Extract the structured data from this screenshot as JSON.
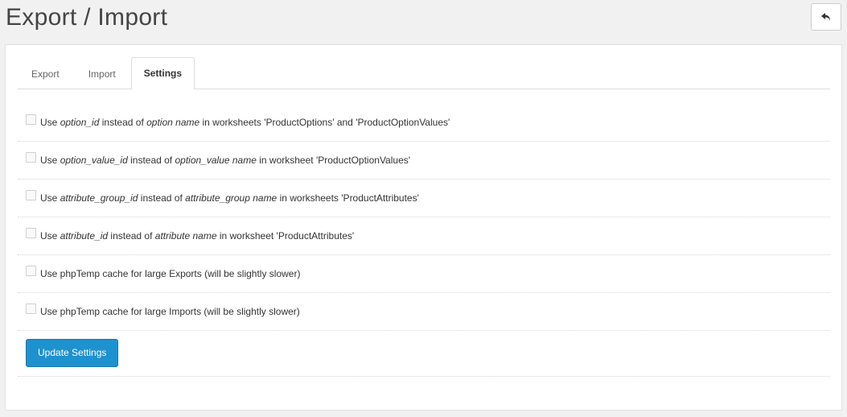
{
  "header": {
    "title": "Export / Import",
    "back_icon": "reply-arrow-icon"
  },
  "tabs": [
    {
      "label": "Export",
      "active": false
    },
    {
      "label": "Import",
      "active": false
    },
    {
      "label": "Settings",
      "active": true
    }
  ],
  "settings": [
    {
      "parts": [
        [
          "Use ",
          false
        ],
        [
          "option_id",
          true
        ],
        [
          " instead of ",
          false
        ],
        [
          "option name",
          true
        ],
        [
          " in worksheets 'ProductOptions' and 'ProductOptionValues'",
          false
        ]
      ],
      "checked": false
    },
    {
      "parts": [
        [
          "Use ",
          false
        ],
        [
          "option_value_id",
          true
        ],
        [
          " instead of ",
          false
        ],
        [
          "option_value name",
          true
        ],
        [
          " in worksheet 'ProductOptionValues'",
          false
        ]
      ],
      "checked": false
    },
    {
      "parts": [
        [
          "Use ",
          false
        ],
        [
          "attribute_group_id",
          true
        ],
        [
          " instead of ",
          false
        ],
        [
          "attribute_group name",
          true
        ],
        [
          " in worksheets 'ProductAttributes'",
          false
        ]
      ],
      "checked": false
    },
    {
      "parts": [
        [
          "Use ",
          false
        ],
        [
          "attribute_id",
          true
        ],
        [
          " instead of ",
          false
        ],
        [
          "attribute name",
          true
        ],
        [
          " in worksheet 'ProductAttributes'",
          false
        ]
      ],
      "checked": false
    },
    {
      "parts": [
        [
          "Use phpTemp cache for large Exports (will be slightly slower)",
          false
        ]
      ],
      "checked": false
    },
    {
      "parts": [
        [
          "Use phpTemp cache for large Imports (will be slightly slower)",
          false
        ]
      ],
      "checked": false
    }
  ],
  "actions": {
    "update_label": "Update Settings"
  },
  "colors": {
    "primary_button": "#1e91cf",
    "background": "#f1f1f1"
  }
}
